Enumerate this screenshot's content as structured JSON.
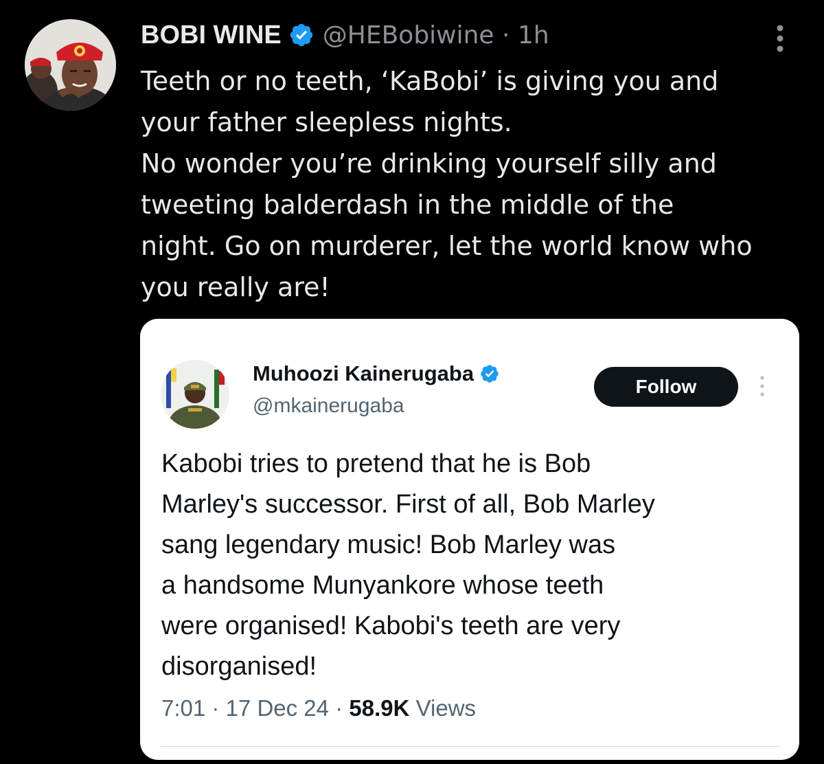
{
  "tweet": {
    "display_name": "BOBI WINE",
    "handle": "@HEBobiwine",
    "separator": "·",
    "time": "1h",
    "body_lines": [
      "Teeth or no teeth, ‘KaBobi’ is giving you and",
      "your father sleepless nights.",
      "No wonder you’re drinking yourself silly and",
      "tweeting balderdash in the middle of the",
      "night. Go on murderer, let the world know who",
      "you really are!"
    ]
  },
  "quoted": {
    "display_name": "Muhoozi Kainerugaba",
    "handle": "@mkainerugaba",
    "follow_label": "Follow",
    "body_lines": [
      "Kabobi tries to pretend that he is Bob",
      "Marley's successor. First of all, Bob Marley",
      "sang legendary music! Bob Marley was",
      "a handsome Munyankore whose teeth",
      "were organised! Kabobi's teeth are very",
      "disorganised!"
    ],
    "time": "7:01",
    "date": "17 Dec 24",
    "separator": "·",
    "views_count": "58.9K",
    "views_label": "Views"
  },
  "colors": {
    "background": "#000000",
    "verified_blue": "#1d9bf0",
    "text_primary": "#e7e9ea",
    "text_secondary": "#8b9197",
    "card_background": "#ffffff"
  },
  "icons": {
    "verified": "verified-badge-icon",
    "more": "more-vertical-icon"
  }
}
